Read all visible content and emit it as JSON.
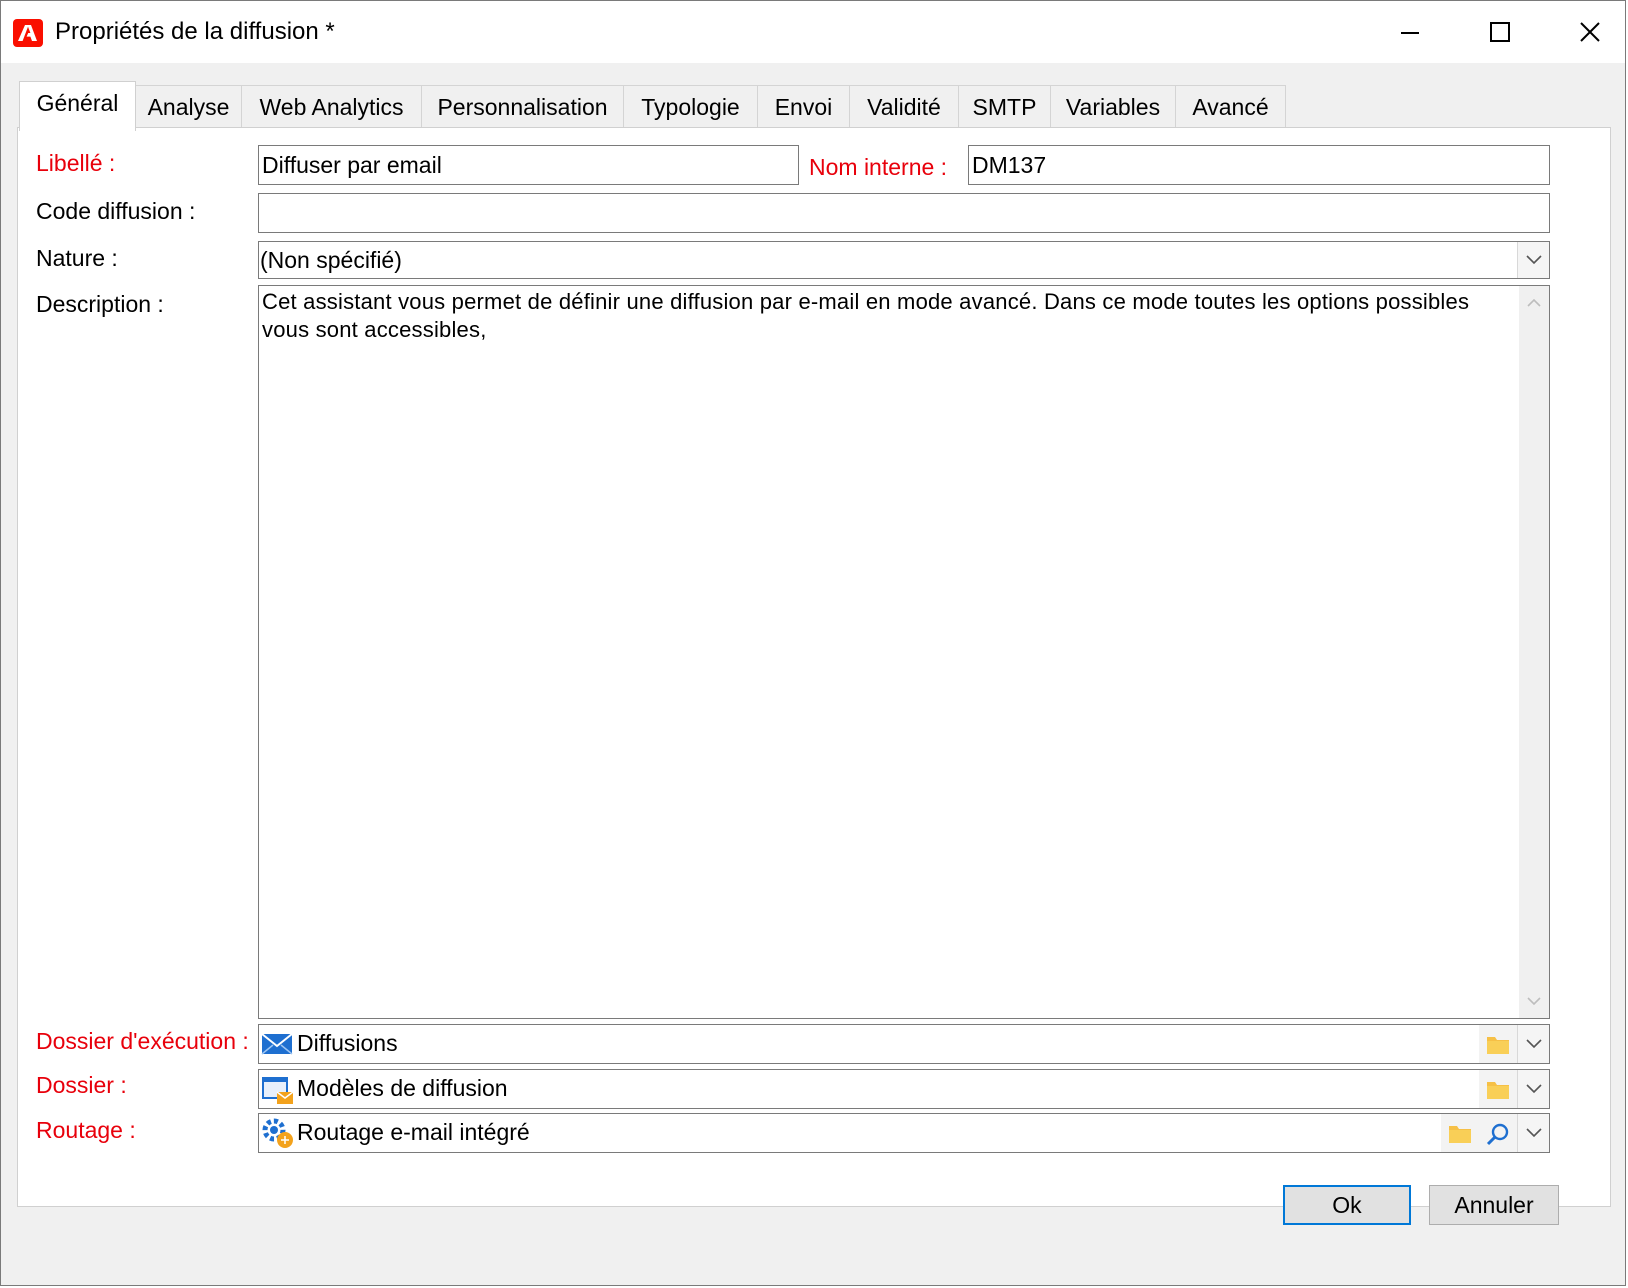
{
  "window": {
    "title": "Propriétés de la diffusion *",
    "accent_color": "#fa0f00"
  },
  "tabs": [
    {
      "label": "Général",
      "active": true
    },
    {
      "label": "Analyse"
    },
    {
      "label": "Web Analytics"
    },
    {
      "label": "Personnalisation"
    },
    {
      "label": "Typologie"
    },
    {
      "label": "Envoi"
    },
    {
      "label": "Validité"
    },
    {
      "label": "SMTP"
    },
    {
      "label": "Variables"
    },
    {
      "label": "Avancé"
    }
  ],
  "form": {
    "libelle_label": "Libellé :",
    "libelle_value": "Diffuser par email",
    "nom_interne_label": "Nom interne :",
    "nom_interne_value": "DM137",
    "code_label": "Code diffusion :",
    "code_value": "",
    "nature_label": "Nature :",
    "nature_value": "(Non spécifié)",
    "description_label": "Description :",
    "description_value": "Cet assistant vous permet de définir une diffusion par e-mail en mode avancé. Dans ce mode toutes les options possibles vous sont accessibles,",
    "exec_folder_label": "Dossier d'exécution :",
    "exec_folder_value": "Diffusions",
    "folder_label": "Dossier :",
    "folder_value": "Modèles de diffusion",
    "routing_label": "Routage :",
    "routing_value": "Routage e-mail intégré",
    "required_color": "#e8000b"
  },
  "buttons": {
    "ok": "Ok",
    "cancel": "Annuler"
  },
  "icons": {
    "app": "adobe-logo-icon",
    "exec_folder": "envelope-icon",
    "folder": "template-folder-icon",
    "routing": "routing-gear-icon",
    "browse": "folder-icon",
    "search": "magnifier-icon"
  }
}
